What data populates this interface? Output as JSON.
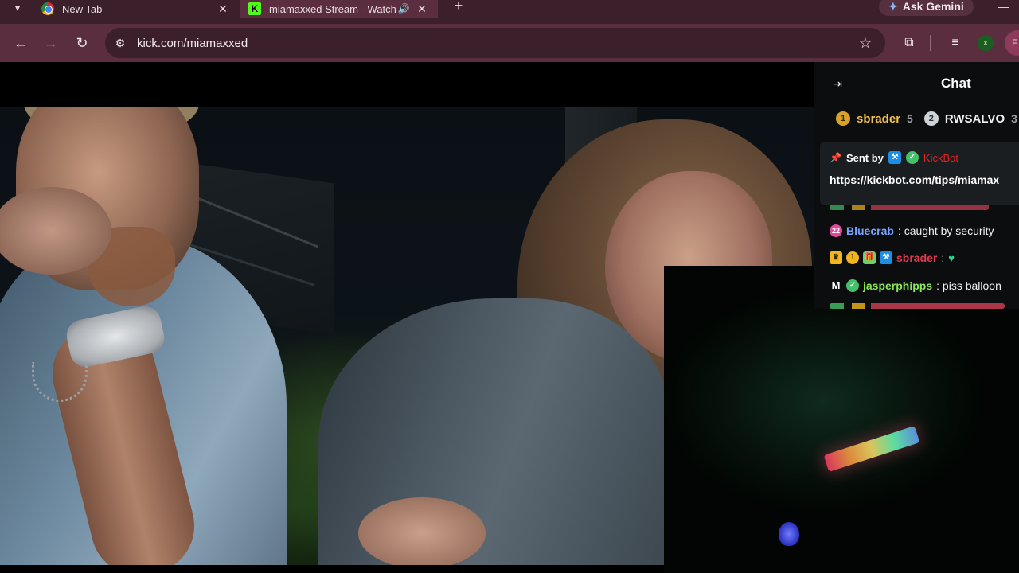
{
  "browser": {
    "tabs": [
      {
        "title": "New Tab",
        "icon": "chrome-icon"
      },
      {
        "title": "miamaxxed Stream - Watch",
        "icon": "kick-icon",
        "audio": true
      }
    ],
    "gemini_label": "Ask Gemini",
    "url": "kick.com/miamaxxed",
    "profile_initial": "F",
    "extension_initial": "x"
  },
  "chat": {
    "title": "Chat",
    "leaderboard": [
      {
        "rank": "1",
        "name": "sbrader",
        "count": "5"
      },
      {
        "rank": "2",
        "name": "RWSALVO",
        "count": "3"
      }
    ],
    "pinned": {
      "sent_by": "Sent by",
      "bot_name": "KickBot",
      "link": "https://kickbot.com/tips/miamax"
    },
    "messages": [
      {
        "badge": "22",
        "user": "Bluecrab",
        "text": ": caught by security"
      },
      {
        "user": "sbrader",
        "text": ":",
        "emote": "green-heart"
      },
      {
        "badge": "M",
        "user": "jasperphipps",
        "text": ": piss balloon"
      }
    ]
  },
  "colors": {
    "tab_bar": "#3b1f2b",
    "toolbar": "#5a2e3f",
    "kick_green": "#53fc18",
    "chat_bg": "#0b0d0e"
  }
}
